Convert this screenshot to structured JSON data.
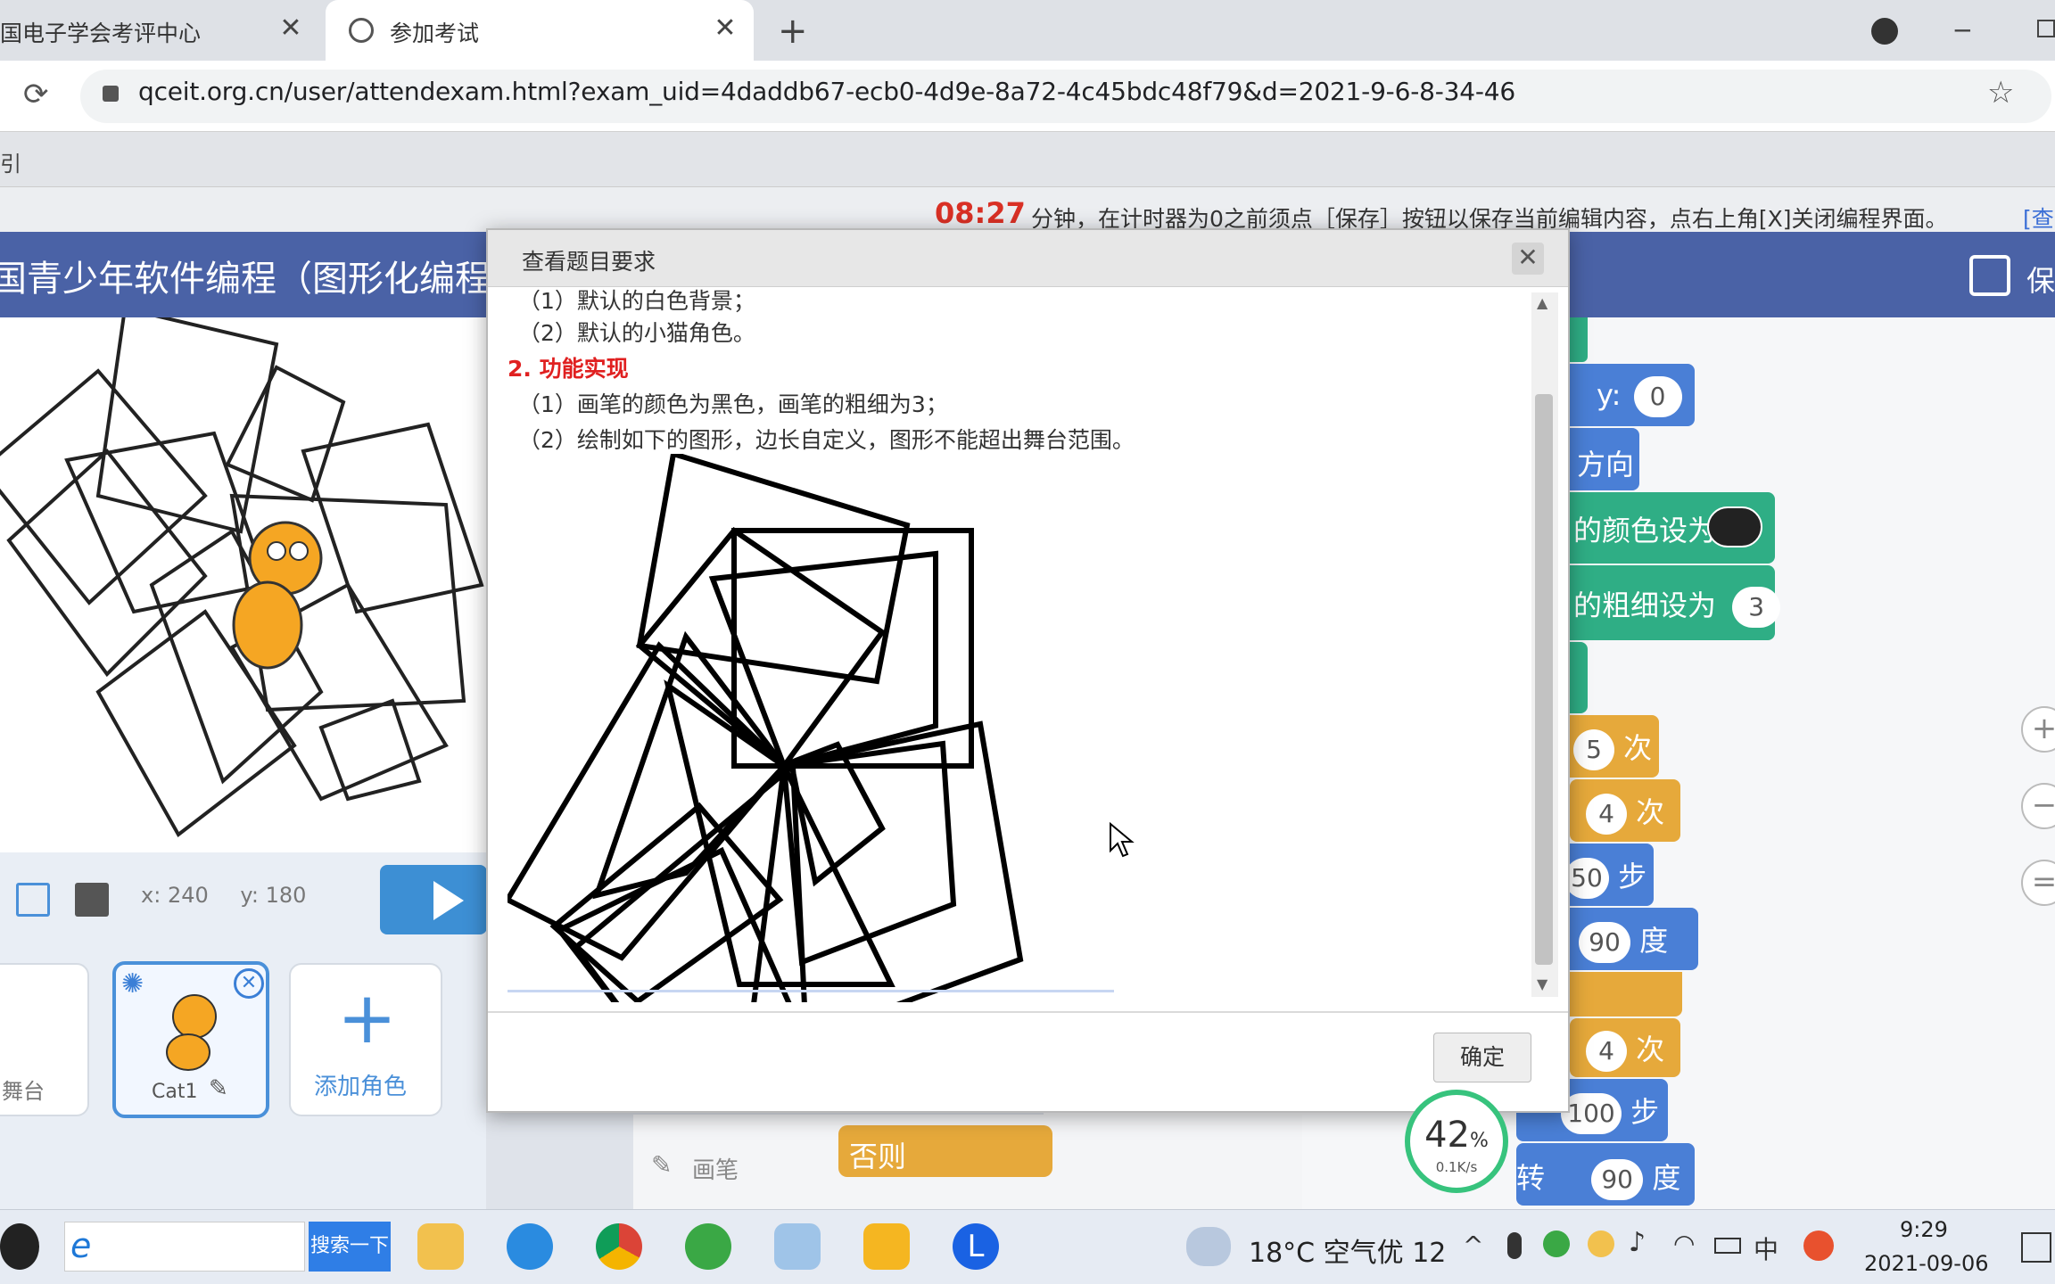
{
  "browser": {
    "tabs": [
      {
        "label": "国电子学会考评中心"
      },
      {
        "label": "参加考试"
      }
    ],
    "url": "qceit.org.cn/user/attendexam.html?exam_uid=4daddb67-ecb0-4d9e-8a72-4c45bdc48f79&d=2021-9-6-8-34-46"
  },
  "page": {
    "breadcrumb_fragment": "引",
    "timer": "08:27",
    "notice": "分钟，在计时器为0之前须点［保存］按钮以保存当前编辑内容，点右上角[X]关闭编程界面。",
    "notice_link": "[查",
    "app_title": "国青少年软件编程（图形化编程）",
    "save_label": "保"
  },
  "stage": {
    "x_label": "x:",
    "x_value": "240",
    "y_label": "y:",
    "y_value": "180"
  },
  "sprites": {
    "stage_label": "舞台",
    "sprite_name": "Cat1",
    "add_label": "添加角色"
  },
  "palette": {
    "category": "画笔",
    "else_block": "否则"
  },
  "script_blocks": {
    "y_label": "y:",
    "y_value": "0",
    "direction": "方向",
    "pen_color": "的颜色设为",
    "pen_size": "的粗细设为",
    "pen_size_value": "3",
    "repeat1": "5",
    "repeat1_unit": "次",
    "repeat2": "4",
    "repeat2_unit": "次",
    "move1": "50",
    "move1_unit": "步",
    "turn1": "90",
    "turn1_unit": "度",
    "repeat3": "4",
    "repeat3_unit": "次",
    "move2": "100",
    "move2_unit": "步",
    "turn2_prefix": "转",
    "turn2": "90",
    "turn2_unit": "度"
  },
  "dialog": {
    "title": "查看题目要求",
    "lines": [
      "（1）默认的白色背景；",
      "（2）默认的小猫角色。",
      "2. 功能实现",
      "（1）画笔的颜色为黑色，画笔的粗细为3；",
      "（2）绘制如下的图形，边长自定义，图形不能超出舞台范围。"
    ],
    "ok_label": "确定"
  },
  "speed": {
    "percent": "42",
    "percent_unit": "%",
    "rate": "0.1K/s"
  },
  "taskbar": {
    "search_button": "搜索一下",
    "weather": "18°C 空气优 12",
    "time": "9:29",
    "date": "2021-09-06",
    "ime": "中"
  },
  "colors": {
    "accent_blue": "#4a62a6",
    "timer_red": "#d93025",
    "block_orange": "#e6a93b",
    "block_green": "#2fae85"
  }
}
